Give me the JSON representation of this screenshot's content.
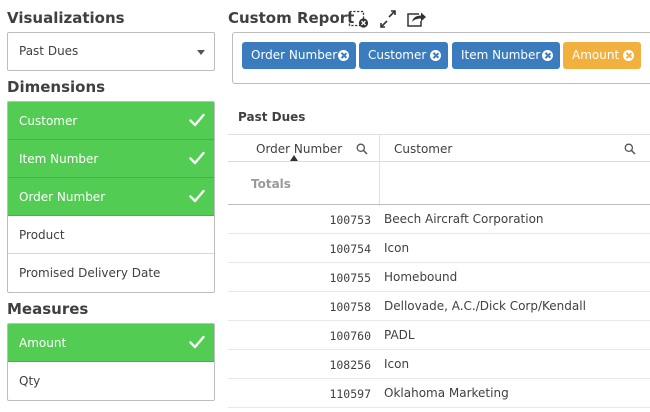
{
  "visualizations": {
    "title": "Visualizations",
    "selected": "Past Dues"
  },
  "dimensions": {
    "title": "Dimensions",
    "items": [
      {
        "label": "Customer",
        "selected": true
      },
      {
        "label": "Item Number",
        "selected": true
      },
      {
        "label": "Order Number",
        "selected": true
      },
      {
        "label": "Product",
        "selected": false
      },
      {
        "label": "Promised Delivery Date",
        "selected": false
      }
    ]
  },
  "measures": {
    "title": "Measures",
    "items": [
      {
        "label": "Amount",
        "selected": true
      },
      {
        "label": "Qty",
        "selected": false
      }
    ]
  },
  "report": {
    "title": "Custom Report",
    "toolbar_icons": [
      "clear-selections-icon",
      "expand-icon",
      "export-icon"
    ],
    "chips": [
      {
        "label": "Order Number",
        "color": "#3a7cbe"
      },
      {
        "label": "Customer",
        "color": "#3a7cbe"
      },
      {
        "label": "Item Number",
        "color": "#3a7cbe"
      },
      {
        "label": "Amount",
        "color": "#f2b13e"
      }
    ]
  },
  "table": {
    "title": "Past Dues",
    "columns": [
      "Order Number",
      "Customer"
    ],
    "totals_label": "Totals",
    "rows": [
      {
        "order": "100753",
        "customer": "Beech Aircraft Corporation"
      },
      {
        "order": "100754",
        "customer": "Icon"
      },
      {
        "order": "100755",
        "customer": "Homebound"
      },
      {
        "order": "100758",
        "customer": "Dellovade, A.C./Dick Corp/Kendall"
      },
      {
        "order": "100760",
        "customer": "PADL"
      },
      {
        "order": "108256",
        "customer": "Icon"
      },
      {
        "order": "110597",
        "customer": "Oklahoma Marketing"
      }
    ]
  },
  "colors": {
    "selected_green": "#52cc52",
    "chip_blue": "#3a7cbe",
    "chip_orange": "#f2b13e"
  }
}
